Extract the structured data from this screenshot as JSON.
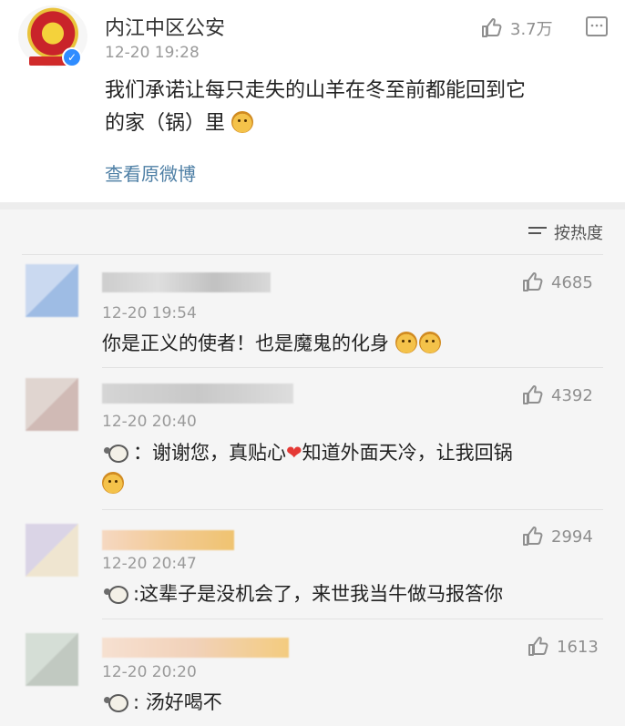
{
  "post": {
    "author": "内江中区公安",
    "time": "12-20 19:28",
    "text_line1": "我们承诺让每只走失的山羊在冬至前都能回到它",
    "text_line2": "的家（锅）里",
    "view_original": "查看原微博",
    "like_count": "3.7万"
  },
  "sort": {
    "label": "按热度"
  },
  "comments": [
    {
      "time": "12-20 19:54",
      "like_count": "4685",
      "text": "你是正义的使者！也是魔鬼的化身"
    },
    {
      "time": "12-20 20:40",
      "like_count": "4392",
      "text_line1_a": "：谢谢您，真贴心",
      "text_line1_b": "知道外面天冷，让我回锅"
    },
    {
      "time": "12-20 20:47",
      "like_count": "2994",
      "text": ":这辈子是没机会了，来世我当牛做马报答你"
    },
    {
      "time": "12-20 20:20",
      "like_count": "1613",
      "text": ": 汤好喝不"
    }
  ],
  "icons": {
    "like": "thumbs-up-icon",
    "comment": "comment-icon",
    "sort": "sort-icon",
    "verified": "verified-badge-icon"
  },
  "colors": {
    "link": "#4e7fa5",
    "muted": "#9a9a9a",
    "verified": "#2f8cff",
    "heart": "#e53935"
  }
}
